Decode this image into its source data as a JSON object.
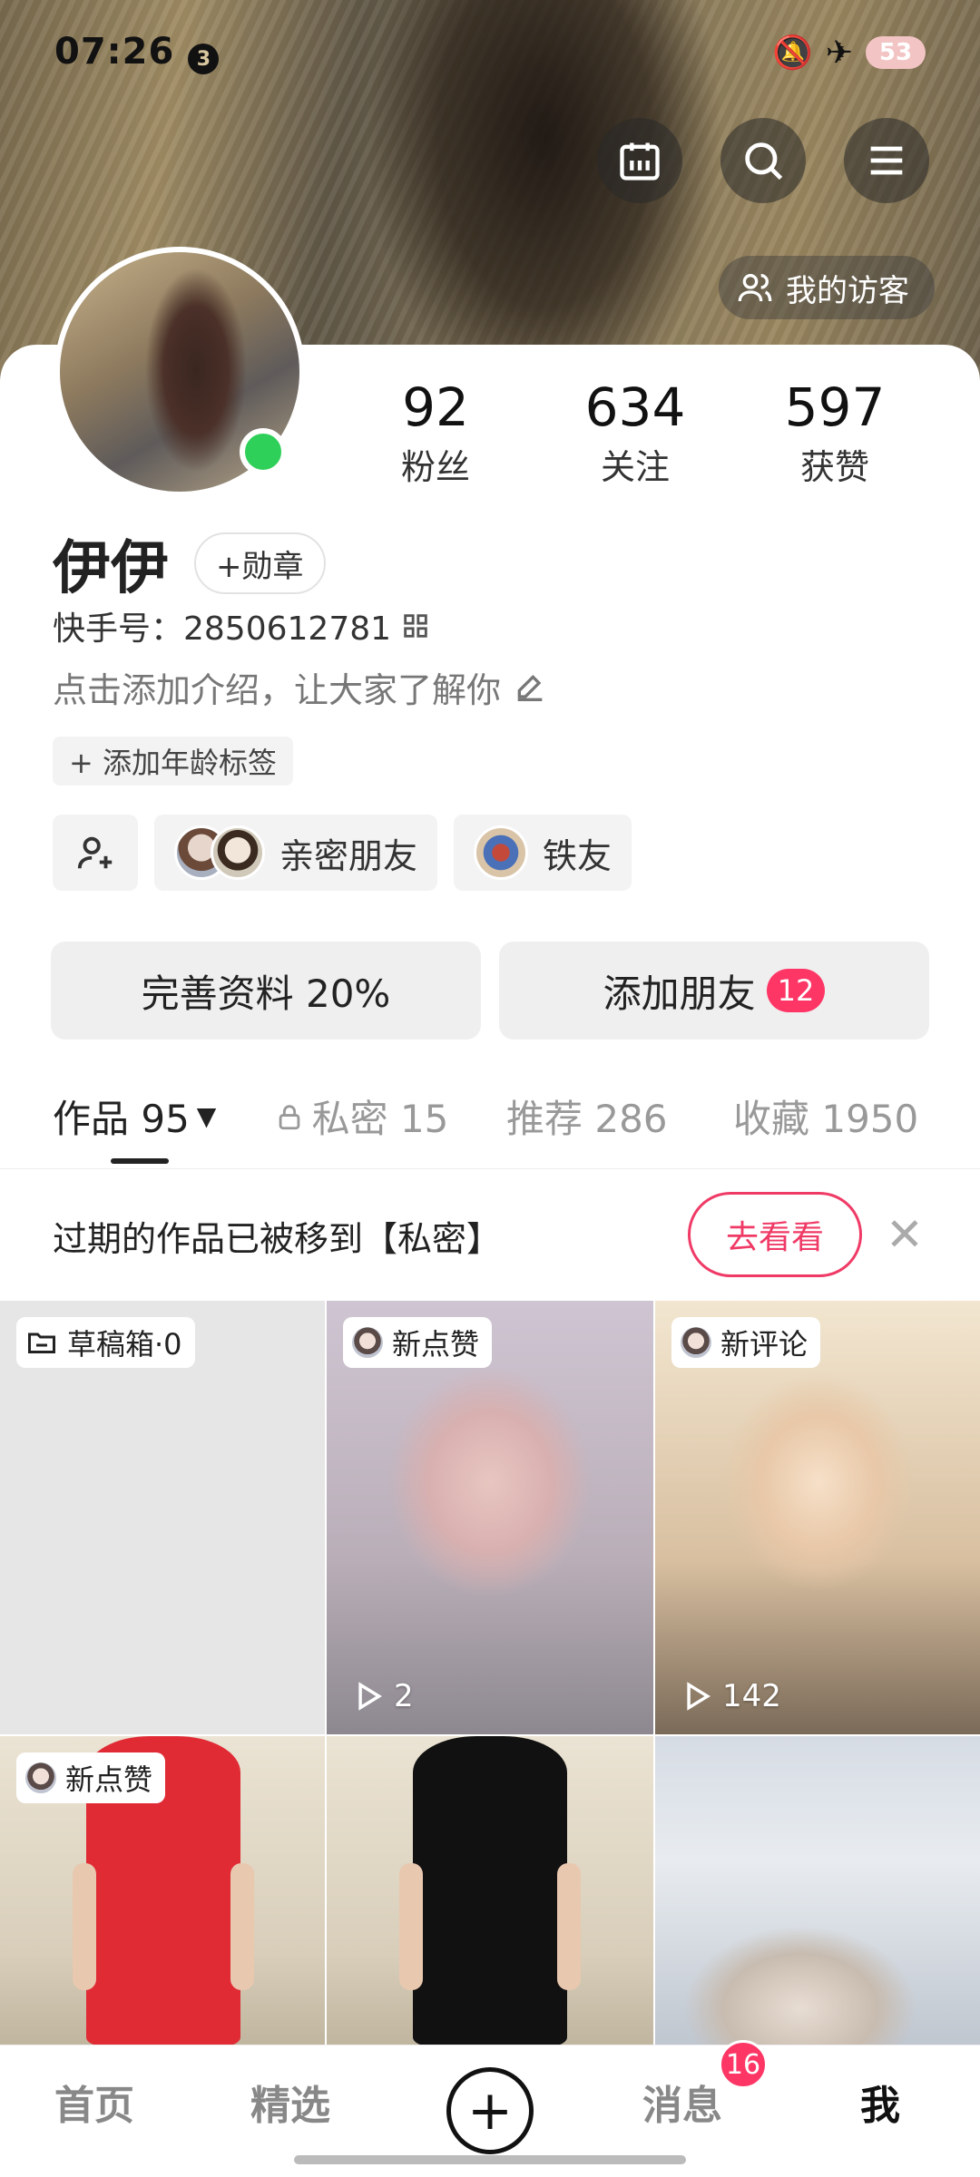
{
  "status_bar": {
    "time": "07:26",
    "notif_count": "3",
    "battery": "53"
  },
  "header": {
    "visitor_label": "我的访客"
  },
  "profile": {
    "name": "伊伊",
    "badge_btn": "+勋章",
    "kuaishou_id": "快手号：2850612781",
    "intro": "点击添加介绍，让大家了解你",
    "age_tag": "+ 添加年龄标签"
  },
  "stats": [
    {
      "num": "92",
      "label": "粉丝"
    },
    {
      "num": "634",
      "label": "关注"
    },
    {
      "num": "597",
      "label": "获赞"
    }
  ],
  "friends": {
    "close_label": "亲密朋友",
    "iron_label": "铁友"
  },
  "actions": {
    "complete_profile": "完善资料 20%",
    "add_friends": "添加朋友",
    "add_friends_count": "12"
  },
  "tabs": [
    {
      "label": "作品 95"
    },
    {
      "label": "私密 15"
    },
    {
      "label": "推荐 286"
    },
    {
      "label": "收藏 1950"
    }
  ],
  "notice": {
    "text": "过期的作品已被移到【私密】",
    "button": "去看看"
  },
  "grid": {
    "draft_label": "草稿箱·0",
    "item2_tag": "新点赞",
    "item2_plays": "2",
    "item3_tag": "新评论",
    "item3_plays": "142",
    "item4_tag": "新点赞"
  },
  "bottom_nav": {
    "home": "首页",
    "featured": "精选",
    "messages": "消息",
    "messages_badge": "16",
    "me": "我"
  }
}
